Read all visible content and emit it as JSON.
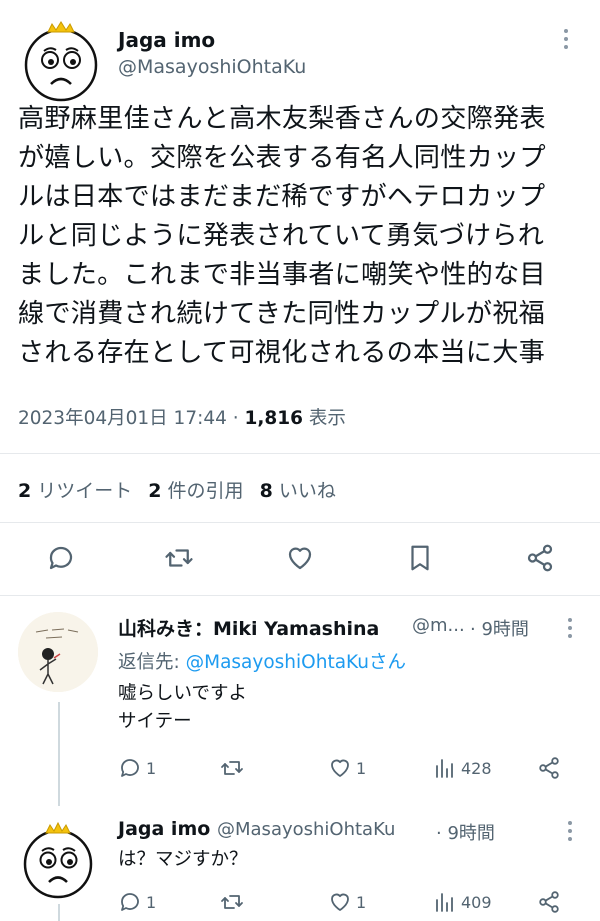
{
  "main_tweet": {
    "display_name": "Jaga imo",
    "handle": "@MasayoshiOhtaKu",
    "text": "高野麻里佳さんと高木友梨香さんの交際発表\nが嬉しい。交際を公表する有名人同性カップ\nルは日本ではまだまだ稀ですがヘテロカップ\nルと同じように発表されていて勇気づけられ\nました。これまで非当事者に嘲笑や性的な目\n線で消費され続けてきた同性カップルが祝福\nされる存在として可視化されるの本当に大事",
    "timestamp": "2023年04月01日 17:44",
    "separator": " · ",
    "views_count": "1,816",
    "views_label": " 表示",
    "retweets_count": "2",
    "retweets_label": " リツイート",
    "quotes_count": "2",
    "quotes_label": " 件の引用",
    "likes_count": "8",
    "likes_label": " いいね"
  },
  "replies": [
    {
      "display_name": "山科みき：Miki Yamashina",
      "handle": "@m...",
      "time": "· 9時間",
      "reply_to_prefix": "返信先: ",
      "reply_to_handle": "@MasayoshiOhtaKu",
      "reply_to_suffix": "さん",
      "text": "嘘らしいですよ\nサイテー",
      "reply_count": "1",
      "retweet_count": "",
      "like_count": "1",
      "view_count": "428"
    },
    {
      "display_name": "Jaga imo",
      "handle": "@MasayoshiOhtaKu",
      "time": "· 9時間",
      "text": "は？マジすか？",
      "reply_count": "1",
      "retweet_count": "",
      "like_count": "1",
      "view_count": "409"
    }
  ],
  "icons": [
    "reply-icon",
    "retweet-icon",
    "like-icon",
    "bookmark-icon",
    "share-icon",
    "views-icon",
    "more-icon"
  ],
  "colors": {
    "text": "#0f1419",
    "secondary": "#536471",
    "link": "#1d9bf0",
    "divider": "#e6e9ec"
  }
}
